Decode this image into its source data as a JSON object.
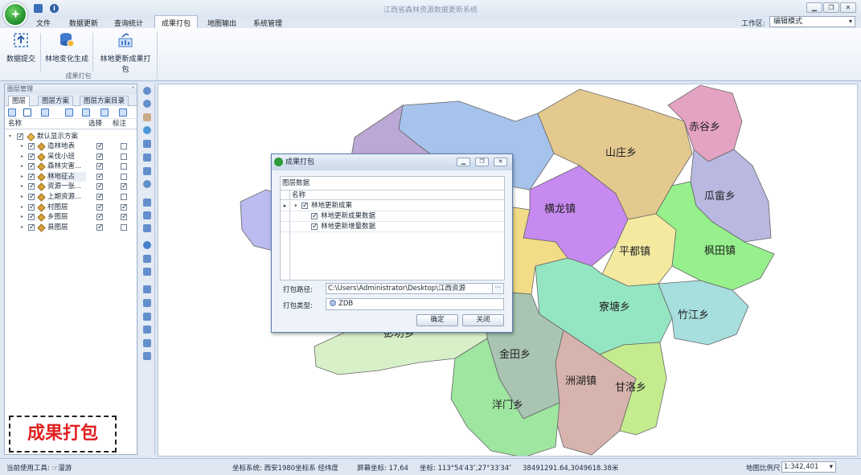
{
  "window": {
    "title": "江西省森林资源数据更新系统",
    "min": "▁",
    "max": "❐",
    "close": "✕"
  },
  "menu": {
    "tabs": [
      "文件",
      "数据更新",
      "查询统计",
      "成果打包",
      "地图输出",
      "系统管理"
    ],
    "active": "成果打包"
  },
  "workspace": {
    "label": "工作区:",
    "value": "编辑模式"
  },
  "ribbon": {
    "buttons": [
      "数据提交",
      "林地变化生成",
      "林地更新成果打包"
    ],
    "group_label": "成果打包"
  },
  "layer_panel": {
    "title": "图层管理",
    "pin": "ᐩ",
    "tabs": [
      "图层",
      "图层方案",
      "图层方案目录"
    ],
    "columns": [
      "名称",
      "选择",
      "标注"
    ],
    "root": "默认显示方案",
    "layers": [
      {
        "name": "造林地表",
        "select": true,
        "label": false
      },
      {
        "name": "采伐小班",
        "select": true,
        "label": false
      },
      {
        "name": "森林灾害...",
        "select": true,
        "label": false
      },
      {
        "name": "林地征占",
        "select": true,
        "label": false
      },
      {
        "name": "资源一张...",
        "select": true,
        "label": true
      },
      {
        "name": "上期资源...",
        "select": true,
        "label": false
      },
      {
        "name": "村图层",
        "select": true,
        "label": true
      },
      {
        "name": "乡图层",
        "select": true,
        "label": true
      },
      {
        "name": "县图层",
        "select": true,
        "label": false
      }
    ]
  },
  "overlay_label": "成果打包",
  "map": {
    "regions": [
      {
        "name": "山庄乡",
        "color": "#e4c98f"
      },
      {
        "name": "赤谷乡",
        "color": "#e4a3c2"
      },
      {
        "name": "瓜畲乡",
        "color": "#b8b8e0"
      },
      {
        "name": "横龙镇",
        "color": "#c78af0"
      },
      {
        "name": "平都镇",
        "color": "#f3eaa0"
      },
      {
        "name": "枫田镇",
        "color": "#96f08c"
      },
      {
        "name": "寮塘乡",
        "color": "#94e6c2"
      },
      {
        "name": "竹江乡",
        "color": "#a7dede"
      },
      {
        "name": "金田乡",
        "color": "#a9c4b2"
      },
      {
        "name": "洲湖镇",
        "color": "#d7b3ad"
      },
      {
        "name": "甘洛乡",
        "color": "#c4ec8e"
      },
      {
        "name": "洋门乡",
        "color": "#9fe6a0"
      },
      {
        "name": "彭坊乡",
        "color": "#d8f0c8"
      }
    ]
  },
  "dialog": {
    "title": "成果打包",
    "group_title": "图层数据",
    "column": "名称",
    "rows": [
      "林地更新成果",
      "林地更新成果数据",
      "林地更新增量数据"
    ],
    "path_label": "打包路径:",
    "path_value": "C:\\Users\\Administrator\\Desktop\\江西资源",
    "type_label": "打包类型:",
    "type_value": "ZDB",
    "ok": "确定",
    "close": "关闭",
    "browse": "···",
    "indicator": "▸"
  },
  "status": {
    "tool": "当前使用工具: ☞漫游",
    "crs": "坐标系统: 西安1980坐标系 经纬度",
    "screen": "屏幕坐标: 17,64",
    "coord": "坐标: 113°54′43″,27°33′34″",
    "proj": "38491291.64,3049618.38米",
    "scale_label": "地图比例尺",
    "scale_value": "1:342,401"
  }
}
